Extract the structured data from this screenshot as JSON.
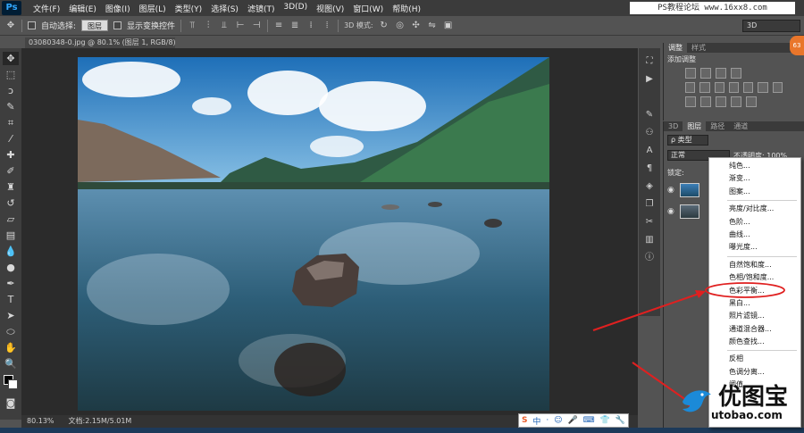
{
  "app": {
    "logo": "Ps",
    "menus": [
      "文件(F)",
      "编辑(E)",
      "图像(I)",
      "图层(L)",
      "类型(Y)",
      "选择(S)",
      "滤镜(T)",
      "3D(D)",
      "视图(V)",
      "窗口(W)",
      "帮助(H)"
    ],
    "watermark_top": "PS教程论坛 www.16xx8.com"
  },
  "options_bar": {
    "auto_select_label": "自动选择:",
    "auto_select_value": "图层",
    "show_transform_label": "显示变换控件",
    "mode_3d_label": "3D 模式:",
    "workspace_value": "3D"
  },
  "document": {
    "tab_title": "03080348-0.jpg @ 80.1% (图层 1, RGB/8) *",
    "zoom": "80.13%",
    "doc_size": "文档:2.15M/5.01M"
  },
  "adjustments": {
    "tabs": [
      "调整",
      "样式"
    ],
    "title": "添加调整"
  },
  "layers": {
    "tabs": [
      "3D",
      "图层",
      "路径",
      "通道"
    ],
    "kind_filter": "ρ 类型",
    "blend_mode": "正常",
    "opacity_label": "不透明度: 100%",
    "lock_label": "锁定:",
    "badge": "63"
  },
  "dropdown": {
    "groups": [
      [
        "纯色...",
        "渐变...",
        "图案..."
      ],
      [
        "亮度/对比度...",
        "色阶...",
        "曲线...",
        "曝光度..."
      ],
      [
        "自然饱和度...",
        "色相/饱和度...",
        "色彩平衡...",
        "黑白...",
        "照片滤镜...",
        "通道混合器...",
        "颜色查找..."
      ],
      [
        "反相",
        "色调分离...",
        "阈值..."
      ]
    ],
    "highlighted": "色彩平衡..."
  },
  "ime": {
    "logo": "S",
    "mode": "中",
    "icons": [
      "·",
      "☺",
      "🎤",
      "⌨",
      "👕",
      "🔧"
    ]
  },
  "watermark_bottom": {
    "text": "优图宝",
    "url": "utobao.com"
  },
  "colors": {
    "annotation": "#e02020",
    "panel": "#535353",
    "canvas": "#2b2b2b"
  }
}
